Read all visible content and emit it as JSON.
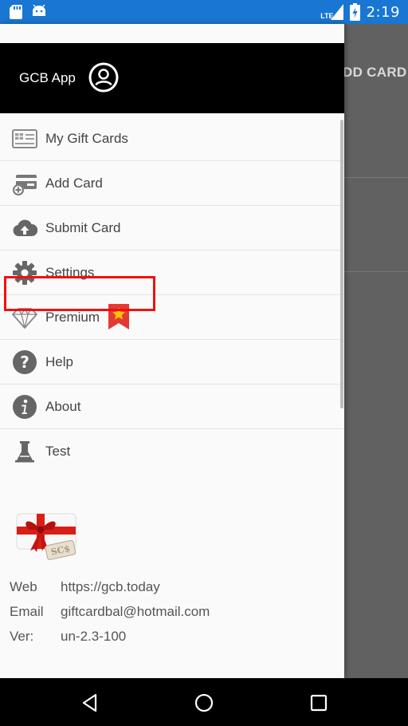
{
  "status_bar": {
    "time": "2:19",
    "network_label": "LTE",
    "icons": [
      "sd-card-icon",
      "android-icon",
      "lte-signal-icon",
      "battery-charging-icon"
    ]
  },
  "background": {
    "toolbar_action": "DD CARD"
  },
  "drawer": {
    "app_title": "GCB App",
    "avatar_icon": "account-circle-icon",
    "menu": [
      {
        "label": "My Gift Cards",
        "icon": "gift-card-icon"
      },
      {
        "label": "Add Card",
        "icon": "add-card-icon"
      },
      {
        "label": "Submit Card",
        "icon": "cloud-upload-icon"
      },
      {
        "label": "Settings",
        "icon": "gear-icon"
      },
      {
        "label": "Premium",
        "icon": "diamond-icon",
        "badge_icon": "star-bookmark-icon"
      },
      {
        "label": "Help",
        "icon": "help-icon"
      },
      {
        "label": "About",
        "icon": "info-icon"
      },
      {
        "label": "Test",
        "icon": "test-tube-icon"
      }
    ],
    "info": {
      "web_label": "Web",
      "web_value": "https://gcb.today",
      "email_label": "Email",
      "email_value": "giftcardbal@hotmail.com",
      "version_label": "Ver:",
      "version_value": "un-2.3-100"
    }
  },
  "nav_bar": {
    "buttons": [
      "back-icon",
      "home-icon",
      "recents-icon"
    ]
  },
  "colors": {
    "status_bar": "#1976d2",
    "header": "#000000",
    "highlight_border": "#ee1111",
    "icon_gray": "#666666",
    "badge_red": "#e53935",
    "badge_star": "#ffc107"
  }
}
